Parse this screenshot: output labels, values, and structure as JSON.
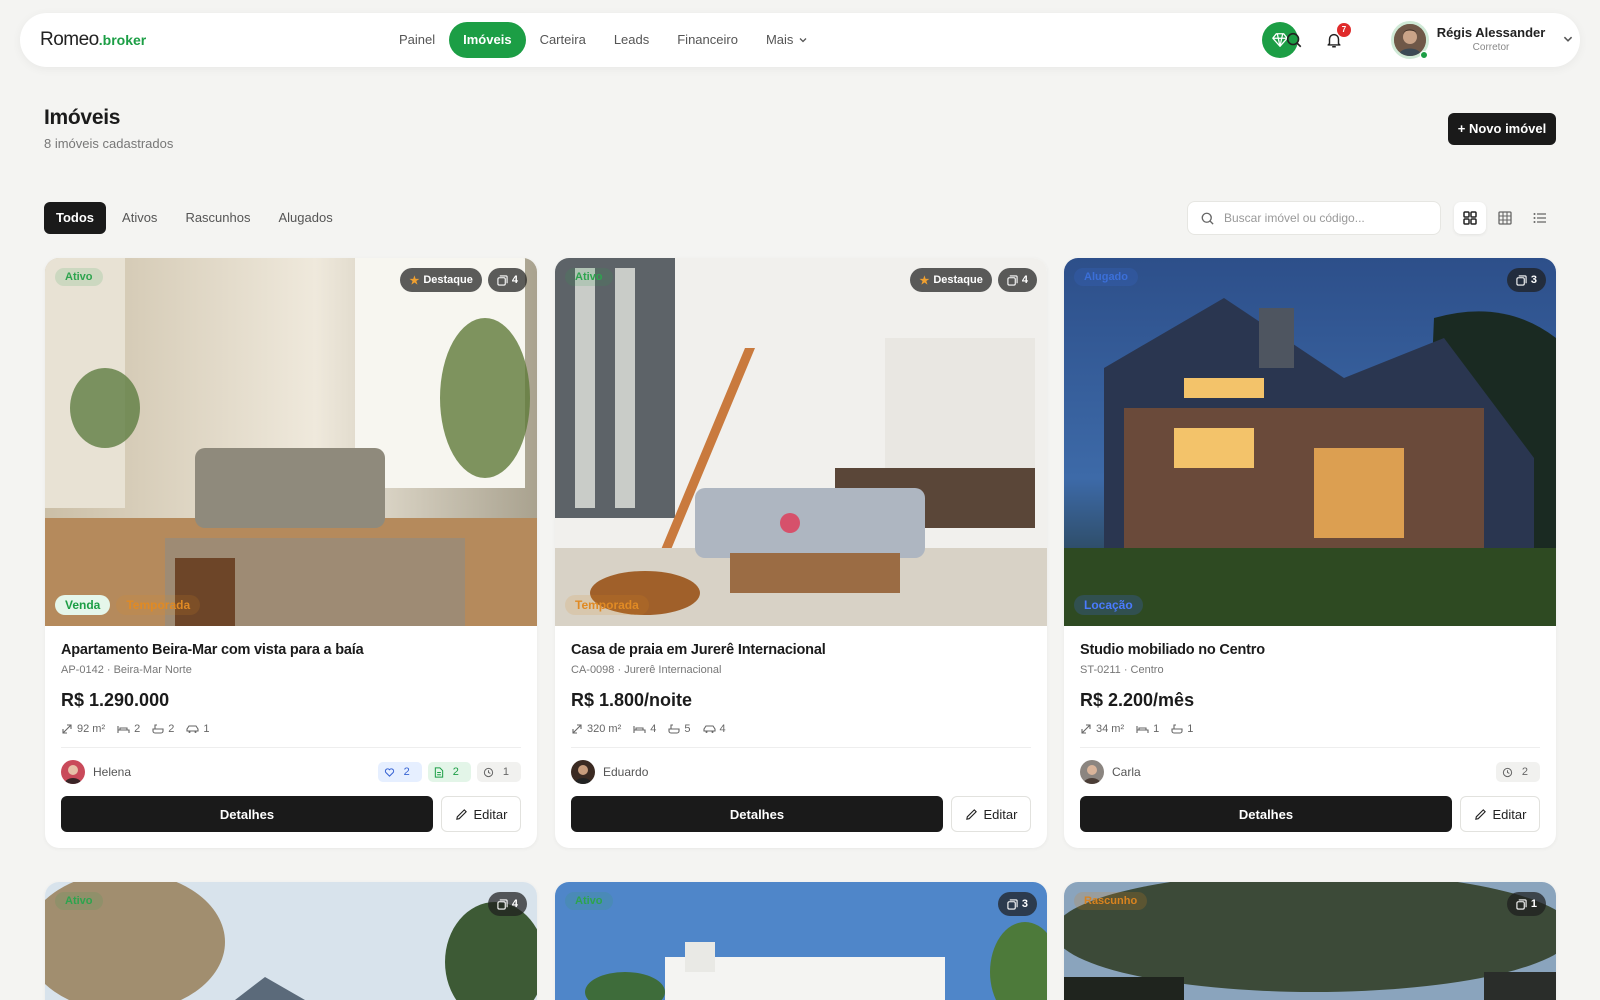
{
  "brand": {
    "name": "Romeo",
    "suffix": ".broker"
  },
  "nav": [
    {
      "label": "Painel"
    },
    {
      "label": "Imóveis",
      "active": true
    },
    {
      "label": "Carteira"
    },
    {
      "label": "Leads"
    },
    {
      "label": "Financeiro"
    },
    {
      "label": "Mais"
    }
  ],
  "header": {
    "notifications": "7",
    "user_name": "Régis Alessander",
    "user_role": "Corretor"
  },
  "page": {
    "title": "Imóveis",
    "subtitle": "8 imóveis cadastrados",
    "new_button": "+ Novo imóvel"
  },
  "filters": [
    "Todos",
    "Ativos",
    "Rascunhos",
    "Alugados"
  ],
  "search": {
    "placeholder": "Buscar imóvel ou código..."
  },
  "cards": [
    {
      "status": "Ativo",
      "featured": "Destaque",
      "photos": "4",
      "tags": [
        "Venda",
        "Temporada"
      ],
      "title": "Apartamento Beira-Mar com vista para a baía",
      "meta": "AP-0142 · Beira-Mar Norte",
      "price": "R$ 1.290.000",
      "area": "92 m²",
      "beds": "2",
      "baths": "2",
      "parking": "1",
      "agent": "Helena",
      "badges": {
        "leads": "2",
        "docs": "2",
        "pending": "1"
      },
      "details": "Detalhes",
      "edit": "Editar"
    },
    {
      "status": "Ativo",
      "featured": "Destaque",
      "photos": "4",
      "tags": [
        "Temporada"
      ],
      "title": "Casa de praia em Jurerê Internacional",
      "meta": "CA-0098 · Jurerê Internacional",
      "price": "R$ 1.800/noite",
      "area": "320 m²",
      "beds": "4",
      "baths": "5",
      "parking": "4",
      "agent": "Eduardo",
      "details": "Detalhes",
      "edit": "Editar"
    },
    {
      "status": "Alugado",
      "photos": "3",
      "tags": [
        "Locação"
      ],
      "title": "Studio mobiliado no Centro",
      "meta": "ST-0211 · Centro",
      "price": "R$ 2.200/mês",
      "area": "34 m²",
      "beds": "1",
      "baths": "1",
      "agent": "Carla",
      "badges": {
        "pending": "2"
      },
      "details": "Detalhes",
      "edit": "Editar"
    },
    {
      "status": "Ativo",
      "photos": "4"
    },
    {
      "status": "Ativo",
      "photos": "3"
    },
    {
      "status": "Rascunho",
      "photos": "1"
    }
  ],
  "colors": {
    "brand_green": "#1c9e45",
    "dark": "#1a1a1a",
    "background": "#f4f4f2"
  }
}
